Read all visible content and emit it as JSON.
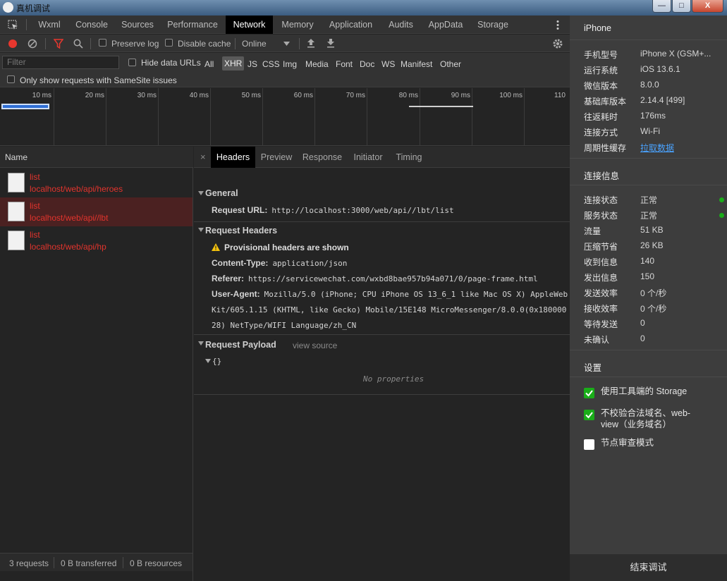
{
  "window": {
    "title": "真机调试",
    "minimize": "—",
    "maximize": "□",
    "close": "X"
  },
  "tabs": [
    "Wxml",
    "Console",
    "Sources",
    "Performance",
    "Network",
    "Memory",
    "Application",
    "Audits",
    "AppData",
    "Storage"
  ],
  "active_tab": "Network",
  "toolbar": {
    "preserve_log": "Preserve log",
    "disable_cache": "Disable cache",
    "throttle": "Online"
  },
  "filter": {
    "placeholder": "Filter",
    "hide_data_urls": "Hide data URLs",
    "types": [
      "All",
      "XHR",
      "JS",
      "CSS",
      "Img",
      "Media",
      "Font",
      "Doc",
      "WS",
      "Manifest",
      "Other"
    ],
    "active_type": "XHR",
    "samesite": "Only show requests with SameSite issues"
  },
  "overview": {
    "ticks": [
      "10 ms",
      "20 ms",
      "30 ms",
      "40 ms",
      "50 ms",
      "60 ms",
      "70 ms",
      "80 ms",
      "90 ms",
      "100 ms",
      "110"
    ]
  },
  "requests": {
    "header": "Name",
    "items": [
      {
        "name": "list",
        "url": "localhost/web/api/heroes"
      },
      {
        "name": "list",
        "url": "localhost/web/api//lbt"
      },
      {
        "name": "list",
        "url": "localhost/web/api/hp"
      }
    ],
    "selected_index": 1
  },
  "status": {
    "requests": "3 requests",
    "transferred": "0 B transferred",
    "resources": "0 B resources"
  },
  "detail_tabs": {
    "close": "×",
    "items": [
      "Headers",
      "Preview",
      "Response",
      "Initiator",
      "Timing"
    ],
    "active": "Headers"
  },
  "general": {
    "title": "General",
    "request_url_label": "Request URL:",
    "request_url": "http://localhost:3000/web/api//lbt/list"
  },
  "request_headers": {
    "title": "Request Headers",
    "warning": "Provisional headers are shown",
    "content_type_label": "Content-Type:",
    "content_type": "application/json",
    "referer_label": "Referer:",
    "referer": "https://servicewechat.com/wxbd8bae957b94a071/0/page-frame.html",
    "user_agent_label": "User-Agent:",
    "user_agent_1": "Mozilla/5.0 (iPhone; CPU iPhone OS 13_6_1 like Mac OS X) AppleWeb",
    "user_agent_2": "Kit/605.1.15 (KHTML, like Gecko) Mobile/15E148 MicroMessenger/8.0.0(0x180000",
    "user_agent_3": "28) NetType/WIFI Language/zh_CN"
  },
  "payload": {
    "title": "Request Payload",
    "view_source": "view source",
    "object": "{}",
    "empty": "No properties"
  },
  "side": {
    "device": "iPhone",
    "info": [
      {
        "k": "手机型号",
        "v": "iPhone X (GSM+..."
      },
      {
        "k": "运行系统",
        "v": "iOS 13.6.1"
      },
      {
        "k": "微信版本",
        "v": "8.0.0"
      },
      {
        "k": "基础库版本",
        "v": "2.14.4 [499]"
      },
      {
        "k": "往返耗时",
        "v": "176ms"
      },
      {
        "k": "连接方式",
        "v": "Wi-Fi"
      },
      {
        "k": "周期性缓存",
        "v": "拉取数据"
      }
    ],
    "connection_title": "连接信息",
    "connection": [
      {
        "k": "连接状态",
        "v": "正常"
      },
      {
        "k": "服务状态",
        "v": "正常"
      },
      {
        "k": "流量",
        "v": "51 KB"
      },
      {
        "k": "压缩节省",
        "v": "26 KB"
      },
      {
        "k": "收到信息",
        "v": "140"
      },
      {
        "k": "发出信息",
        "v": "150"
      },
      {
        "k": "发送效率",
        "v": "0 个/秒"
      },
      {
        "k": "接收效率",
        "v": "0 个/秒"
      },
      {
        "k": "等待发送",
        "v": "0"
      },
      {
        "k": "未确认",
        "v": "0"
      }
    ],
    "settings_title": "设置",
    "settings": [
      {
        "label": "使用工具端的 Storage",
        "checked": true
      },
      {
        "label": "不校验合法域名、web-view（业务域名）",
        "checked": true
      },
      {
        "label": "节点审查模式",
        "checked": false
      }
    ],
    "end_button": "结束调试"
  },
  "colors": {
    "error_red": "#e2342d",
    "record_red": "#e8372e",
    "status_green": "#1aad19",
    "link_blue": "#4aa3ff"
  }
}
